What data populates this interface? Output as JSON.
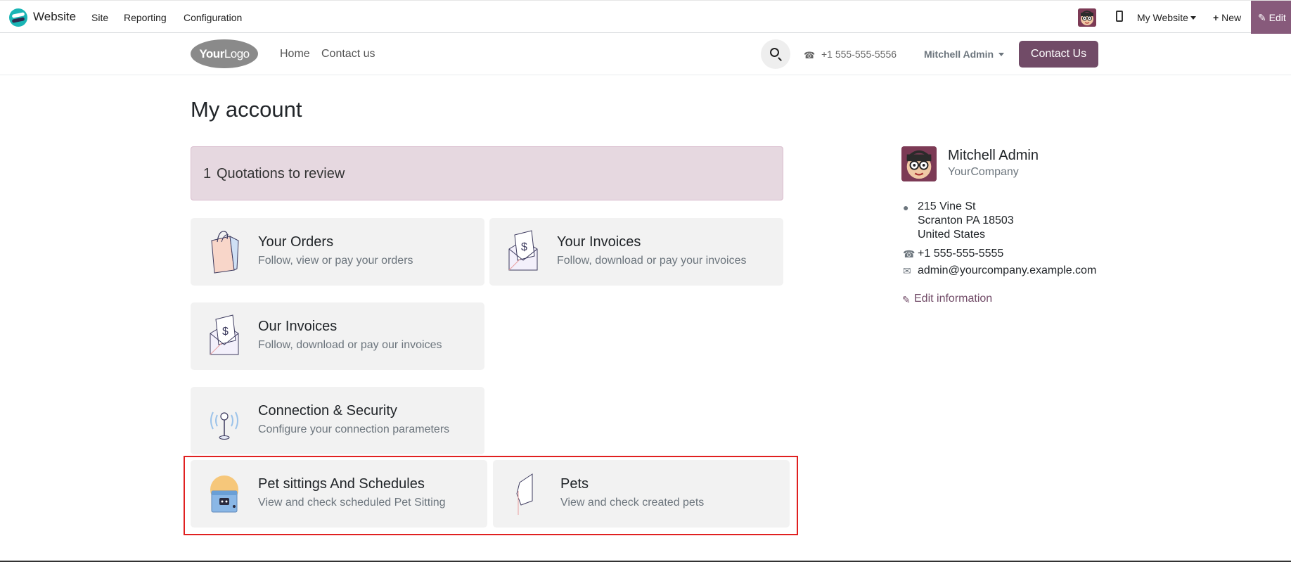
{
  "topbar": {
    "app_name": "Website",
    "menu": [
      "Site",
      "Reporting",
      "Configuration"
    ],
    "website_selector": "My Website",
    "new_label": "New",
    "edit_label": "Edit"
  },
  "header": {
    "logo_bold": "Your",
    "logo_light": "Logo",
    "nav": [
      "Home",
      "Contact us"
    ],
    "phone": "+1 555-555-5556",
    "user": "Mitchell Admin",
    "contact_button": "Contact Us"
  },
  "main": {
    "title": "My account",
    "alert": {
      "count": "1",
      "text": "Quotations to review"
    },
    "cards": [
      {
        "title": "Your Orders",
        "subtitle": "Follow, view or pay your orders",
        "icon": "shopping-bag-icon"
      },
      {
        "title": "Your Invoices",
        "subtitle": "Follow, download or pay your invoices",
        "icon": "invoice-envelope-icon"
      },
      {
        "title": "Our Invoices",
        "subtitle": "Follow, download or pay our invoices",
        "icon": "invoice-envelope-icon"
      },
      {
        "title": "Connection & Security",
        "subtitle": "Configure your connection parameters",
        "icon": "antenna-icon"
      },
      {
        "title": "Pet sittings And Schedules",
        "subtitle": "View and check scheduled Pet Sitting",
        "icon": "pet-sitting-icon"
      },
      {
        "title": "Pets",
        "subtitle": "View and check created pets",
        "icon": "pet-icon"
      }
    ]
  },
  "sidebar": {
    "name": "Mitchell Admin",
    "company": "YourCompany",
    "address": [
      "215 Vine St",
      "Scranton PA 18503",
      "United States"
    ],
    "phone": "+1 555-555-5555",
    "email": "admin@yourcompany.example.com",
    "edit_label": "Edit information"
  },
  "colors": {
    "brand": "#714b67",
    "edit_tab": "#875a7b",
    "alert_bg": "#e6d8e0",
    "highlight": "#e02020"
  }
}
